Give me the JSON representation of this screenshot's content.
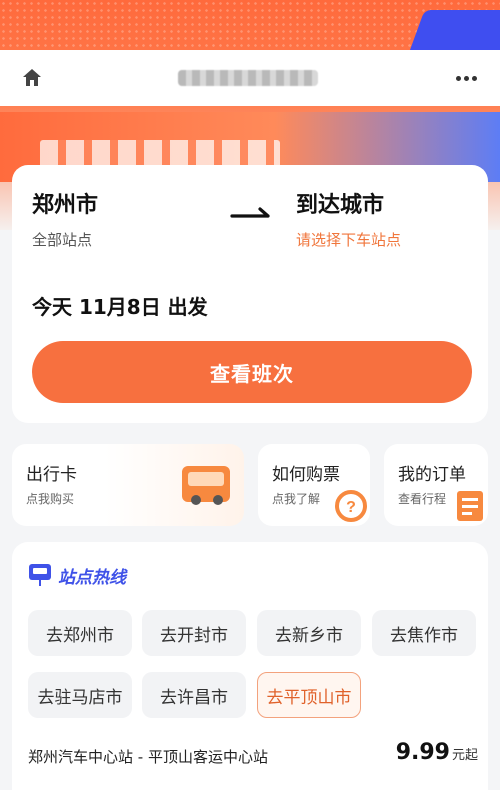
{
  "header": {
    "home_icon": "home-icon",
    "more_icon": "more-icon"
  },
  "trip": {
    "from_city": "郑州市",
    "from_sub": "全部站点",
    "to_city": "到达城市",
    "to_sub": "请选择下车站点",
    "date_line": "今天 11月8日 出发",
    "search_label": "查看班次"
  },
  "quick_cards": [
    {
      "title": "出行卡",
      "subtitle": "点我购买",
      "icon": "bus-card-icon"
    },
    {
      "title": "如何购票",
      "subtitle": "点我了解",
      "icon": "question-icon"
    },
    {
      "title": "我的订单",
      "subtitle": "查看行程",
      "icon": "order-icon"
    }
  ],
  "hotline": {
    "title": "站点热线",
    "chips": [
      "去郑州市",
      "去开封市",
      "去新乡市",
      "去焦作市",
      "去驻马店市",
      "去许昌市",
      "去平顶山市"
    ],
    "active_chip": "去平顶山市",
    "route": "郑州汽车中心站 - 平顶山客运中心站",
    "price_value": "9.99",
    "price_unit": "元起"
  },
  "colors": {
    "accent": "#f7703f",
    "hot_title": "#3f52e8",
    "active_chip_border": "#f3a27d"
  }
}
